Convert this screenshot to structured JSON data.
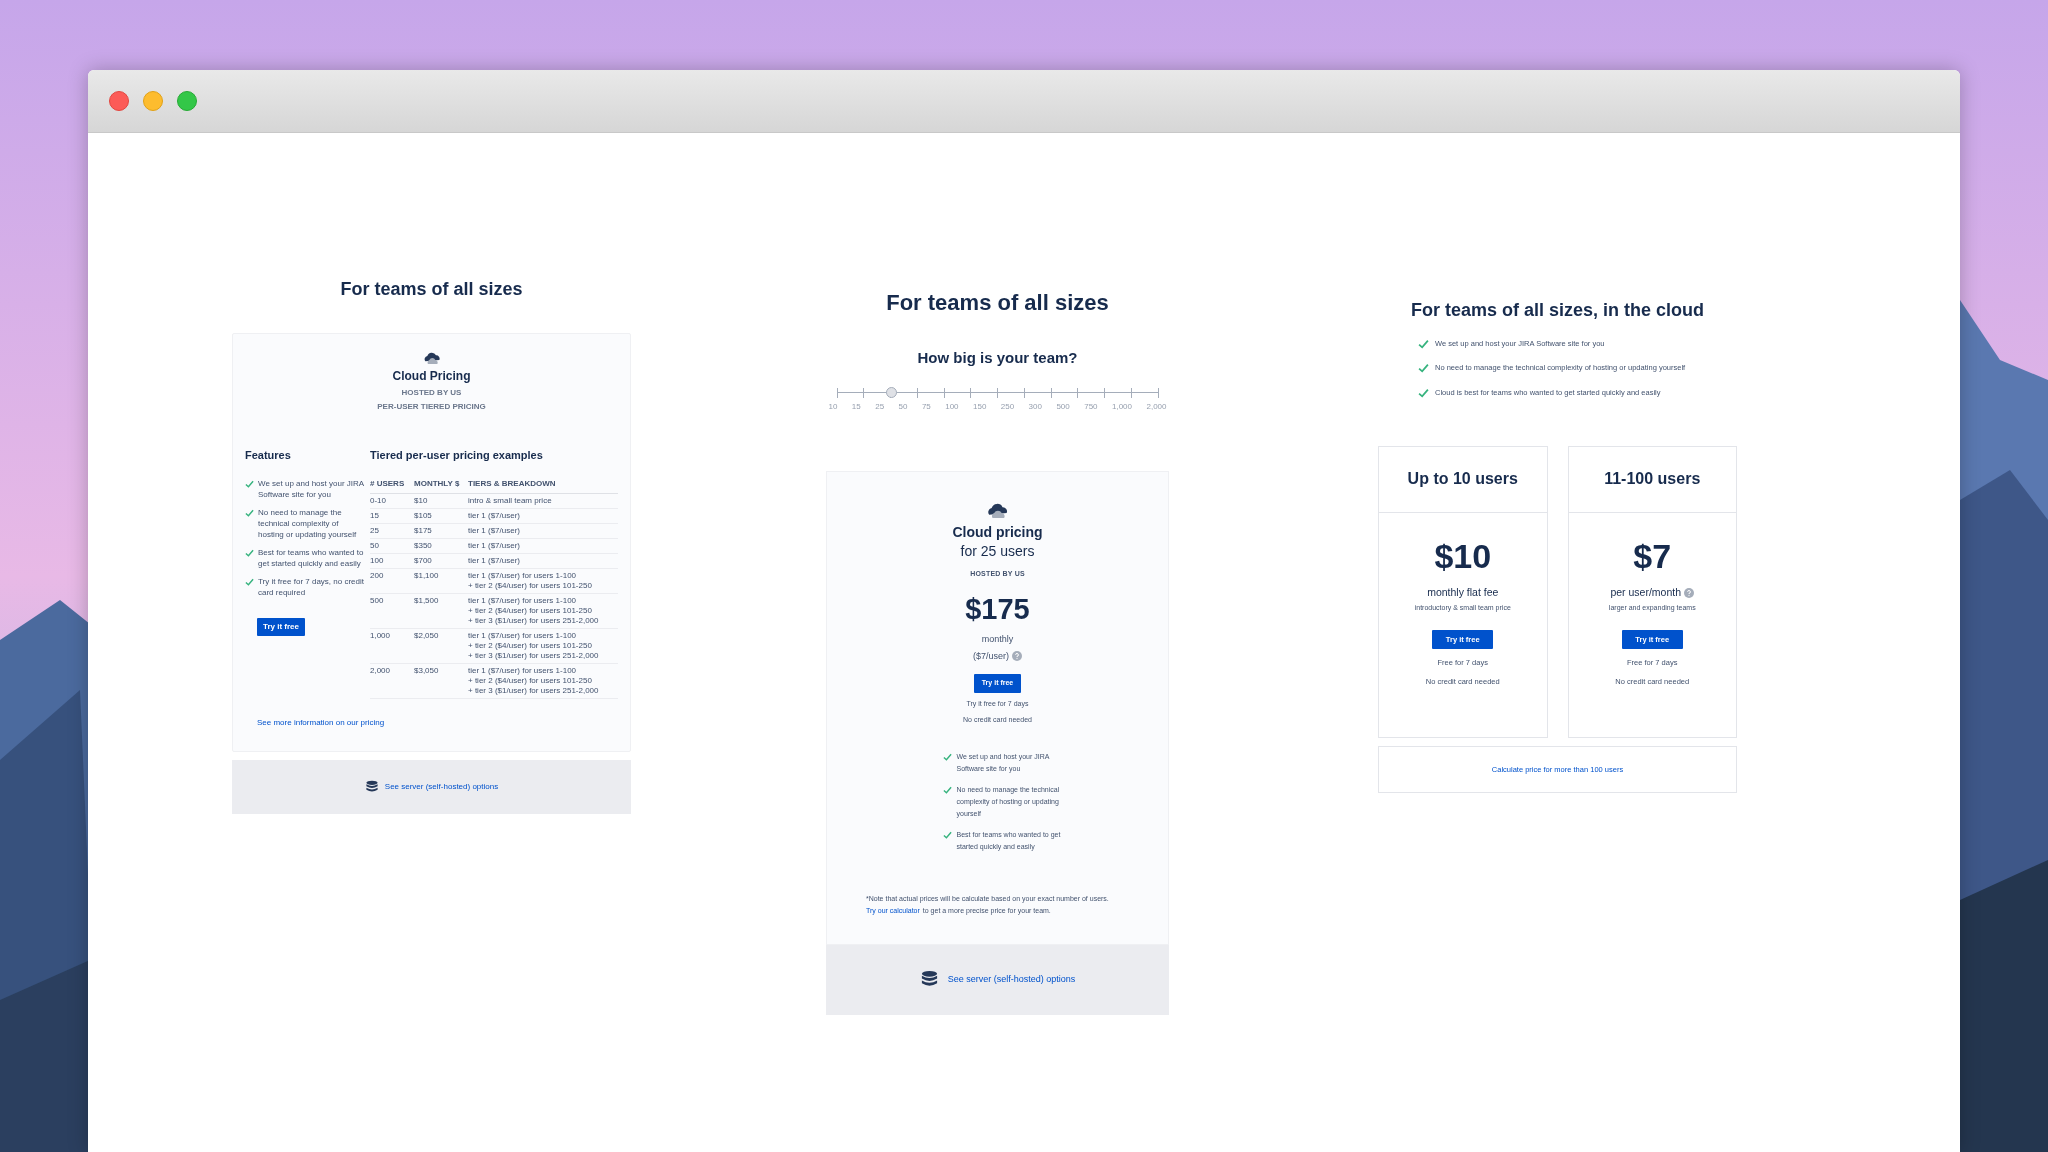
{
  "left": {
    "heading": "For teams of all sizes",
    "card": {
      "title": "Cloud Pricing",
      "subtitles": [
        "HOSTED BY US",
        "PER-USER TIERED PRICING"
      ],
      "features_heading": "Features",
      "features": [
        "We set up and host your JIRA Software site for you",
        "No need to manage the technical complexity of hosting or updating yourself",
        "Best for teams who wanted to get started quickly and easily",
        "Try it free for 7 days, no credit card required"
      ],
      "button": "Try it free",
      "table_heading": "Tiered per-user pricing examples",
      "columns": [
        "# USERS",
        "MONTHLY $",
        "TIERS & BREAKDOWN"
      ],
      "rows": [
        {
          "users": "0-10",
          "monthly": "$10",
          "tiers": [
            "intro & small team price"
          ]
        },
        {
          "users": "15",
          "monthly": "$105",
          "tiers": [
            "tier 1 ($7/user)"
          ]
        },
        {
          "users": "25",
          "monthly": "$175",
          "tiers": [
            "tier 1 ($7/user)"
          ]
        },
        {
          "users": "50",
          "monthly": "$350",
          "tiers": [
            "tier 1 ($7/user)"
          ]
        },
        {
          "users": "100",
          "monthly": "$700",
          "tiers": [
            "tier 1 ($7/user)"
          ]
        },
        {
          "users": "200",
          "monthly": "$1,100",
          "tiers": [
            "tier 1 ($7/user) for users 1-100",
            "+ tier 2 ($4/user) for users 101-250"
          ]
        },
        {
          "users": "500",
          "monthly": "$1,500",
          "tiers": [
            "tier 1 ($7/user) for users 1-100",
            "+ tier 2 ($4/user) for users 101-250",
            "+ tier 3 ($1/user) for users 251-2,000"
          ]
        },
        {
          "users": "1,000",
          "monthly": "$2,050",
          "tiers": [
            "tier 1 ($7/user) for users 1-100",
            "+ tier 2 ($4/user) for users 101-250",
            "+ tier 3 ($1/user) for users 251-2,000"
          ]
        },
        {
          "users": "2,000",
          "monthly": "$3,050",
          "tiers": [
            "tier 1 ($7/user) for users 1-100",
            "+ tier 2 ($4/user) for users 101-250",
            "+ tier 3 ($1/user) for users 251-2,000"
          ]
        }
      ],
      "link": "See more information on our pricing"
    },
    "footer_link": "See server (self-hosted) options"
  },
  "middle": {
    "heading": "For teams of all sizes",
    "question": "How big is your team?",
    "slider": {
      "ticks": [
        "10",
        "15",
        "25",
        "50",
        "75",
        "100",
        "150",
        "250",
        "300",
        "500",
        "750",
        "1,000",
        "2,000"
      ],
      "level": 0.17
    },
    "card": {
      "title": "Cloud pricing",
      "subtitle": "for 25 users",
      "hosted": "HOSTED BY US",
      "price": "$175",
      "period": "monthly",
      "per_user": "($7/user)",
      "button": "Try it free",
      "notes": [
        "Try it free for 7 days",
        "No credit card needed"
      ],
      "features": [
        "We set up and host your JIRA Software site for you",
        "No need to manage the technical complexity of hosting or updating yourself",
        "Best for teams who wanted to get started quickly and easily"
      ],
      "note": "*Note that actual prices will be calculate based on your exact number of users.",
      "note_link": "Try our calculator",
      "note_rest": "to get a more precise price for your team."
    },
    "footer_link": "See server (self-hosted) options"
  },
  "right": {
    "heading": "For teams of all sizes, in the cloud",
    "features": [
      "We set up and host your JIRA Software site for you",
      "No need to manage the technical complexity of hosting or updating yourself",
      "Cloud is best for teams who wanted to get started quickly and easily"
    ],
    "plans": [
      {
        "title": "Up to 10 users",
        "price": "$10",
        "unit": "monthly flat fee",
        "info": false,
        "description": "introductory & small team price",
        "button": "Try it free",
        "notes": [
          "Free for 7 days",
          "No credit card needed"
        ]
      },
      {
        "title": "11-100 users",
        "price": "$7",
        "unit": "per user/month",
        "info": true,
        "description": "larger and expanding teams",
        "button": "Try it free",
        "notes": [
          "Free for 7 days",
          "No credit card needed"
        ]
      }
    ],
    "calc_link": "Calculate price for more than 100 users"
  }
}
